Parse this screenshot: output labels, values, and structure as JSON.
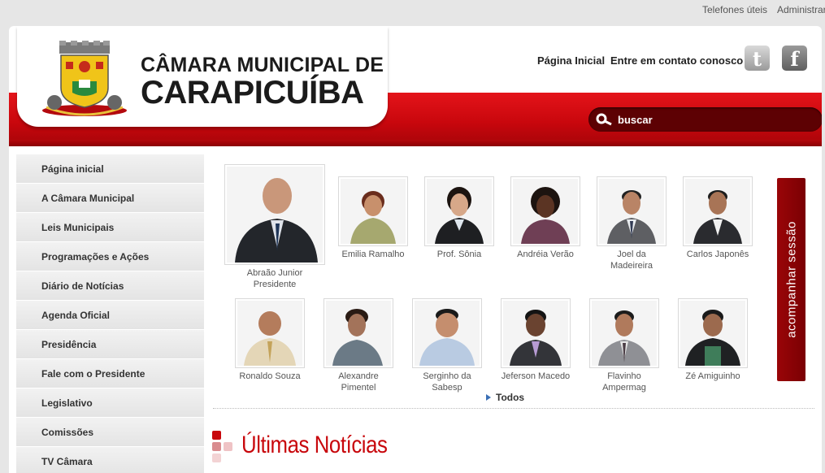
{
  "utility_links": {
    "phones": "Telefones úteis",
    "admin": "Administrar"
  },
  "header": {
    "title_line1": "CÂMARA MUNICIPAL DE",
    "title_line2": "CARAPICUÍBA",
    "links": {
      "home": "Página Inicial",
      "contact": "Entre em contato conosco"
    },
    "social": {
      "twitter_icon": "twitter-icon",
      "facebook_icon": "facebook-icon"
    },
    "search_placeholder": "buscar"
  },
  "sidebar": {
    "items": [
      {
        "label": "Página inicial"
      },
      {
        "label": "A Câmara Municipal"
      },
      {
        "label": "Leis Municipais"
      },
      {
        "label": "Programações e Ações"
      },
      {
        "label": "Diário de Notícias"
      },
      {
        "label": "Agenda Oficial"
      },
      {
        "label": "Presidência"
      },
      {
        "label": "Fale com o Presidente"
      },
      {
        "label": "Legislativo"
      },
      {
        "label": "Comissões"
      },
      {
        "label": "TV Câmara"
      }
    ]
  },
  "president": {
    "name": "Abraão Junior",
    "role": "Presidente"
  },
  "councilors_row1": [
    {
      "name": "Emilia Ramalho"
    },
    {
      "name": "Prof. Sônia"
    },
    {
      "name": "Andréia Verão"
    },
    {
      "name": "Joel da\nMadeireira"
    },
    {
      "name": "Carlos Japonês"
    }
  ],
  "councilors_row2": [
    {
      "name": "Ronaldo Souza"
    },
    {
      "name": "Alexandre\nPimentel"
    },
    {
      "name": "Serginho da\nSabesp"
    },
    {
      "name": "Jeferson Macedo"
    },
    {
      "name": "Flavinho\nAmpermag"
    },
    {
      "name": "Zé Amiguinho"
    }
  ],
  "all_link": "Todos",
  "session_button": "acompanhar sessão",
  "news": {
    "title": "Últimas Notícias"
  },
  "colors": {
    "brand_red": "#c8070c",
    "dark_red": "#7a0003"
  }
}
